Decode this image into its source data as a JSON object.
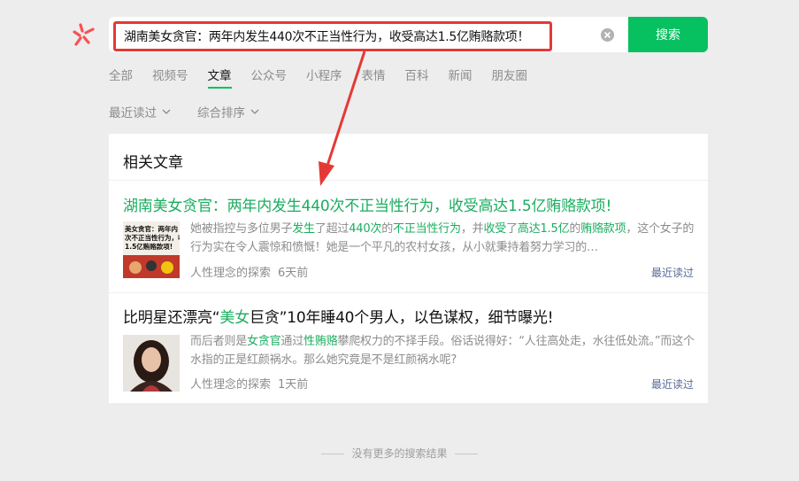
{
  "search": {
    "query": "湖南美女贪官：两年内发生440次不正当性行为，收受高达1.5亿贿赂款项！",
    "button_label": "搜索"
  },
  "tabs": [
    {
      "label": "全部"
    },
    {
      "label": "视频号"
    },
    {
      "label": "文章"
    },
    {
      "label": "公众号"
    },
    {
      "label": "小程序"
    },
    {
      "label": "表情"
    },
    {
      "label": "百科"
    },
    {
      "label": "新闻"
    },
    {
      "label": "朋友圈"
    }
  ],
  "active_tab": "文章",
  "filters": [
    {
      "label": "最近读过"
    },
    {
      "label": "综合排序"
    }
  ],
  "section_title": "相关文章",
  "results": [
    {
      "title": "湖南美女贪官：两年内发生440次不正当性行为，收受高达1.5亿贿赂款项!",
      "snippet_parts": [
        {
          "text": "她被指控与多位男子",
          "hl": false
        },
        {
          "text": "发生",
          "hl": true
        },
        {
          "text": "了超过",
          "hl": false
        },
        {
          "text": "440次",
          "hl": true
        },
        {
          "text": "的",
          "hl": false
        },
        {
          "text": "不正当性行为",
          "hl": true
        },
        {
          "text": "，并",
          "hl": false
        },
        {
          "text": "收受",
          "hl": true
        },
        {
          "text": "了",
          "hl": false
        },
        {
          "text": "高达1.5亿",
          "hl": true
        },
        {
          "text": "的",
          "hl": false
        },
        {
          "text": "贿赂款项",
          "hl": true
        },
        {
          "text": "，这个女子的行为实在令人震惊和愤慨！她是一个平凡的农村女孩，从小就秉持着努力学习的…",
          "hl": false
        }
      ],
      "thumb_text": [
        "美女贪官：两年内",
        "次不正当性行为，收",
        "1.5亿贿赂款项!"
      ],
      "source": "人性理念的探索",
      "time": "6天前",
      "recent_label": "最近读过"
    },
    {
      "title_parts": [
        {
          "text": "比明星还漂亮“",
          "hl": false
        },
        {
          "text": "美女",
          "hl": true
        },
        {
          "text": "巨贪”10年睡40个男人，以色谋权，细节曝光!",
          "hl": false
        }
      ],
      "snippet_parts": [
        {
          "text": "而后者则是",
          "hl": false
        },
        {
          "text": "女贪官",
          "hl": true
        },
        {
          "text": "通过",
          "hl": false
        },
        {
          "text": "性贿赂",
          "hl": true
        },
        {
          "text": "攀爬权力的不择手段。俗话说得好：“人往高处走，水往低处流。”而这个水指的正是红颜祸水。那么她究竟是不是红颜祸水呢?",
          "hl": false
        }
      ],
      "source": "人性理念的探索",
      "time": "1天前",
      "recent_label": "最近读过"
    }
  ],
  "footer": "没有更多的搜索结果",
  "colors": {
    "brand_green": "#07c160",
    "highlight_green": "#1aad5f",
    "annotation_red": "#e53935",
    "link_blue": "#576b95"
  }
}
